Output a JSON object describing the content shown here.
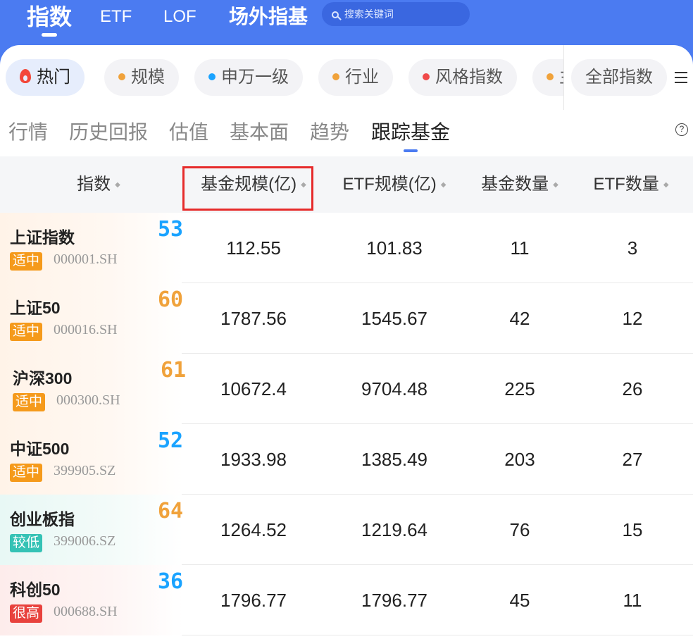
{
  "top_tabs": [
    {
      "label": "指数",
      "active": true
    },
    {
      "label": "ETF",
      "active": false
    },
    {
      "label": "LOF",
      "active": false
    },
    {
      "label": "场外指基",
      "active": false
    }
  ],
  "search": {
    "placeholder": "搜索关键词"
  },
  "chips": [
    {
      "label": "热门",
      "icon": "flame-icon",
      "dot_color": "#f3473a",
      "active": true
    },
    {
      "label": "规模",
      "dot_color": "#f0a23b"
    },
    {
      "label": "申万一级",
      "dot_color": "#1aa3ff"
    },
    {
      "label": "行业",
      "dot_color": "#f0a23b"
    },
    {
      "label": "风格指数",
      "dot_color": "#f04a4a"
    },
    {
      "label": "主",
      "dot_color": "#f0a23b"
    }
  ],
  "all_index_label": "全部指数",
  "sub_tabs": [
    {
      "label": "行情"
    },
    {
      "label": "历史回报"
    },
    {
      "label": "估值"
    },
    {
      "label": "基本面"
    },
    {
      "label": "趋势"
    },
    {
      "label": "跟踪基金",
      "active": true
    }
  ],
  "help_label": "?",
  "table": {
    "headers": [
      "指数",
      "基金规模(亿)",
      "ETF规模(亿)",
      "基金数量",
      "ETF数量"
    ],
    "sort_glyph": "◆",
    "rows": [
      {
        "name": "上证指数",
        "score": "53",
        "score_color": "#1aa3ff",
        "badge": "适中",
        "badge_color": "#f59a1b",
        "code": "000001.SH",
        "fund_size": "112.55",
        "etf_size": "101.83",
        "fund_count": "11",
        "etf_count": "3"
      },
      {
        "name": "上证50",
        "score": "60",
        "score_color": "#f0a23b",
        "badge": "适中",
        "badge_color": "#f59a1b",
        "code": "000016.SH",
        "fund_size": "1787.56",
        "etf_size": "1545.67",
        "fund_count": "42",
        "etf_count": "12"
      },
      {
        "name": "沪深300",
        "score": "61",
        "score_color": "#f0a23b",
        "badge": "适中",
        "badge_color": "#f59a1b",
        "code": "000300.SH",
        "fund_size": "10672.4",
        "etf_size": "9704.48",
        "fund_count": "225",
        "etf_count": "26"
      },
      {
        "name": "中证500",
        "score": "52",
        "score_color": "#1aa3ff",
        "badge": "适中",
        "badge_color": "#f59a1b",
        "code": "399905.SZ",
        "fund_size": "1933.98",
        "etf_size": "1385.49",
        "fund_count": "203",
        "etf_count": "27"
      },
      {
        "name": "创业板指",
        "score": "64",
        "score_color": "#f0a23b",
        "badge": "较低",
        "badge_color": "#35c2b5",
        "code": "399006.SZ",
        "fund_size": "1264.52",
        "etf_size": "1219.64",
        "fund_count": "76",
        "etf_count": "15"
      },
      {
        "name": "科创50",
        "score": "36",
        "score_color": "#1aa3ff",
        "badge": "很高",
        "badge_color": "#e8423d",
        "code": "000688.SH",
        "fund_size": "1796.77",
        "etf_size": "1796.77",
        "fund_count": "45",
        "etf_count": "11"
      }
    ]
  }
}
